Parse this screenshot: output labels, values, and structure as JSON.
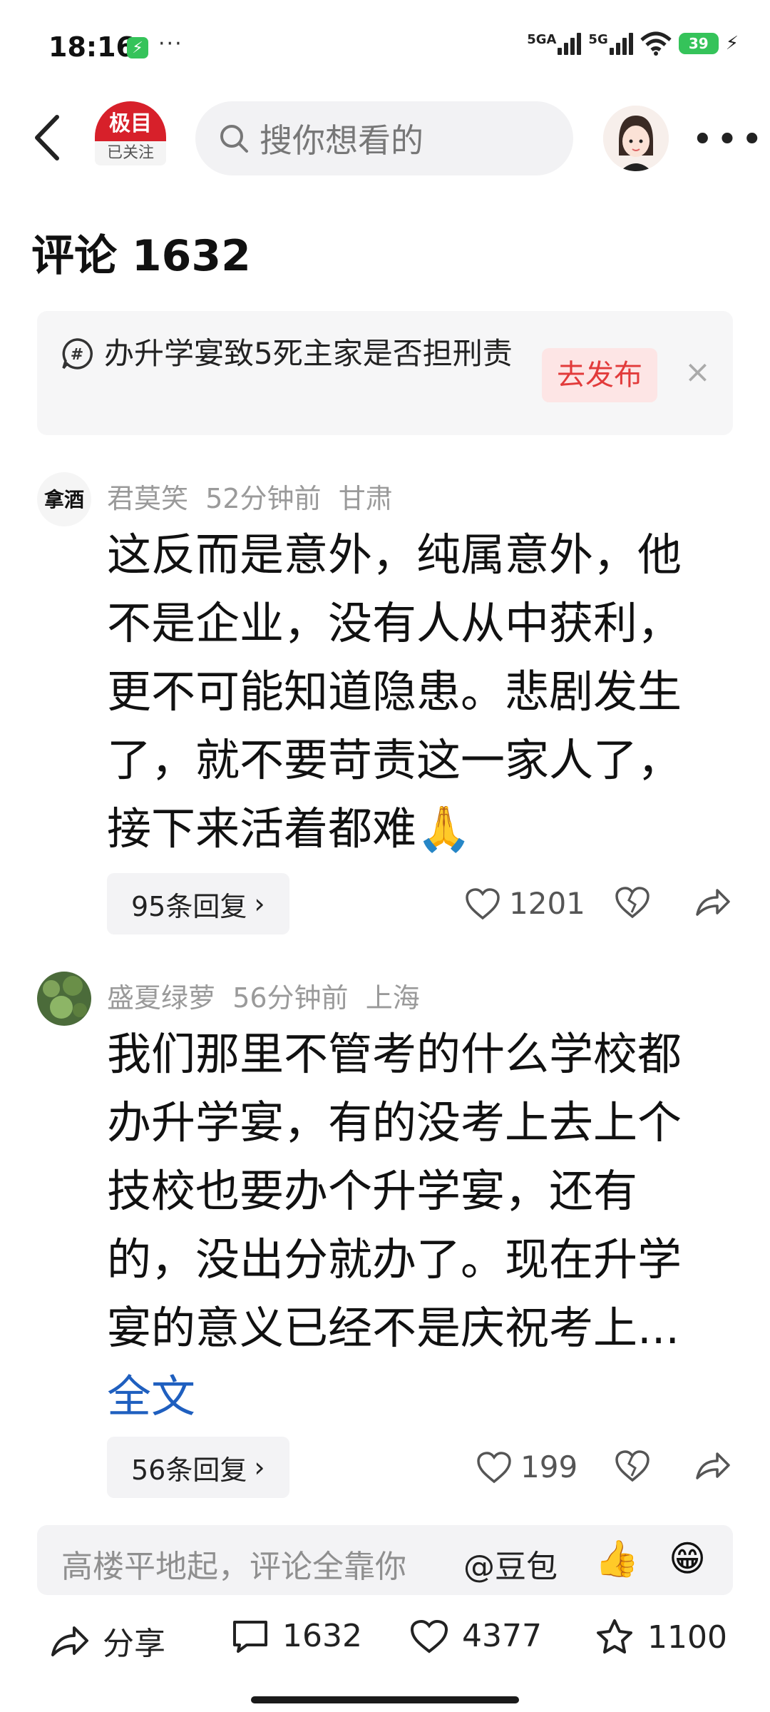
{
  "status_bar": {
    "time": "18:16",
    "dots": "···",
    "net1": "5GA",
    "net2": "5G",
    "battery": "39"
  },
  "header": {
    "source_logo_text": "极目",
    "follow_status": "已关注",
    "search_placeholder": "搜你想看的"
  },
  "comments_title": "评论 1632",
  "topic_banner": {
    "text": "办升学宴致5死主家是否担刑责",
    "publish_label": "去发布",
    "close": "×"
  },
  "comments": [
    {
      "user": "君莫笑",
      "time": "52分钟前",
      "location": "甘肃",
      "text": "这反而是意外，纯属意外，他不是企业，没有人从中获利，更不可能知道隐患。悲剧发生了，就不要苛责这一家人了，接下来活着都难🙏",
      "replies": "95条回复",
      "likes": "1201"
    },
    {
      "user": "盛夏绿萝",
      "time": "56分钟前",
      "location": "上海",
      "text": "我们那里不管考的什么学校都办升学宴，有的没考上去上个技校也要办个升学宴，还有的，没出分就办了。现在升学宴的意义已经不是庆祝考上...",
      "full_link": "全文",
      "replies": "56条回复",
      "likes": "199"
    }
  ],
  "input_bar": {
    "placeholder": "高楼平地起，评论全靠你",
    "mention": "@豆包",
    "emoji1": "👍",
    "emoji2": "😁"
  },
  "bottom_bar": {
    "share_label": "分享",
    "comment_count": "1632",
    "like_count": "4377",
    "favorite_count": "1100"
  },
  "colors": {
    "accent_red": "#d7202a",
    "link_blue": "#1f5fbf",
    "battery_green": "#35c35a"
  }
}
